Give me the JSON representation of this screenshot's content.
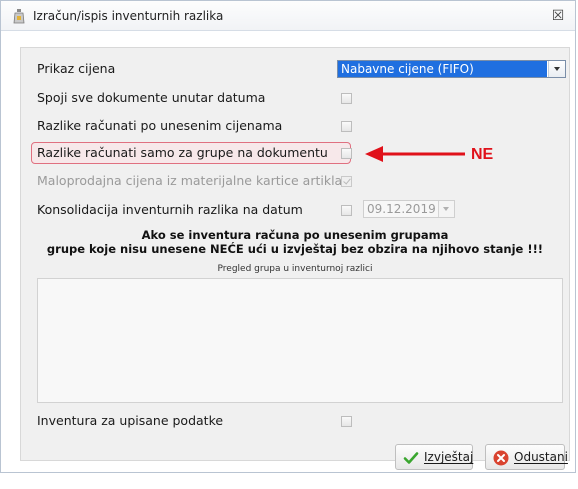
{
  "window": {
    "title": "Izračun/ispis inventurnih razlika",
    "close_glyph": "☒"
  },
  "rows": {
    "price_display": {
      "label": "Prikaz cijena",
      "value": "Nabavne cijene (FIFO)"
    },
    "merge_docs": {
      "label": "Spoji sve dokumente unutar datuma",
      "checked": false
    },
    "diff_entered_prices": {
      "label": "Razlike računati po unesenim cijenama",
      "checked": false
    },
    "diff_groups_only": {
      "label": "Razlike računati samo za grupe na dokumentu",
      "checked": false
    },
    "retail_from_card": {
      "label": "Maloprodajna cijena iz materijalne kartice artikla",
      "checked": true,
      "disabled": true
    },
    "consolidation": {
      "label": "Konsolidacija inventurnih razlika na datum",
      "checked": false,
      "date": "09.12.2019"
    }
  },
  "notice": {
    "line1": "Ako se inventura računa po unesenim grupama",
    "line2": "grupe koje nisu unesene NEĆE ući u izvještaj bez obzira na njihovo stanje !!!"
  },
  "groups": {
    "caption": "Pregled grupa u inventurnoj razlici"
  },
  "entered_data": {
    "label": "Inventura za upisane podatke",
    "checked": false
  },
  "buttons": {
    "report": "Izvještaj",
    "cancel": "Odustani"
  },
  "annotation": {
    "label": "NE",
    "color": "#e0111a"
  },
  "colors": {
    "select_highlight": "#1f6fe0",
    "highlight_border": "#e07080"
  }
}
